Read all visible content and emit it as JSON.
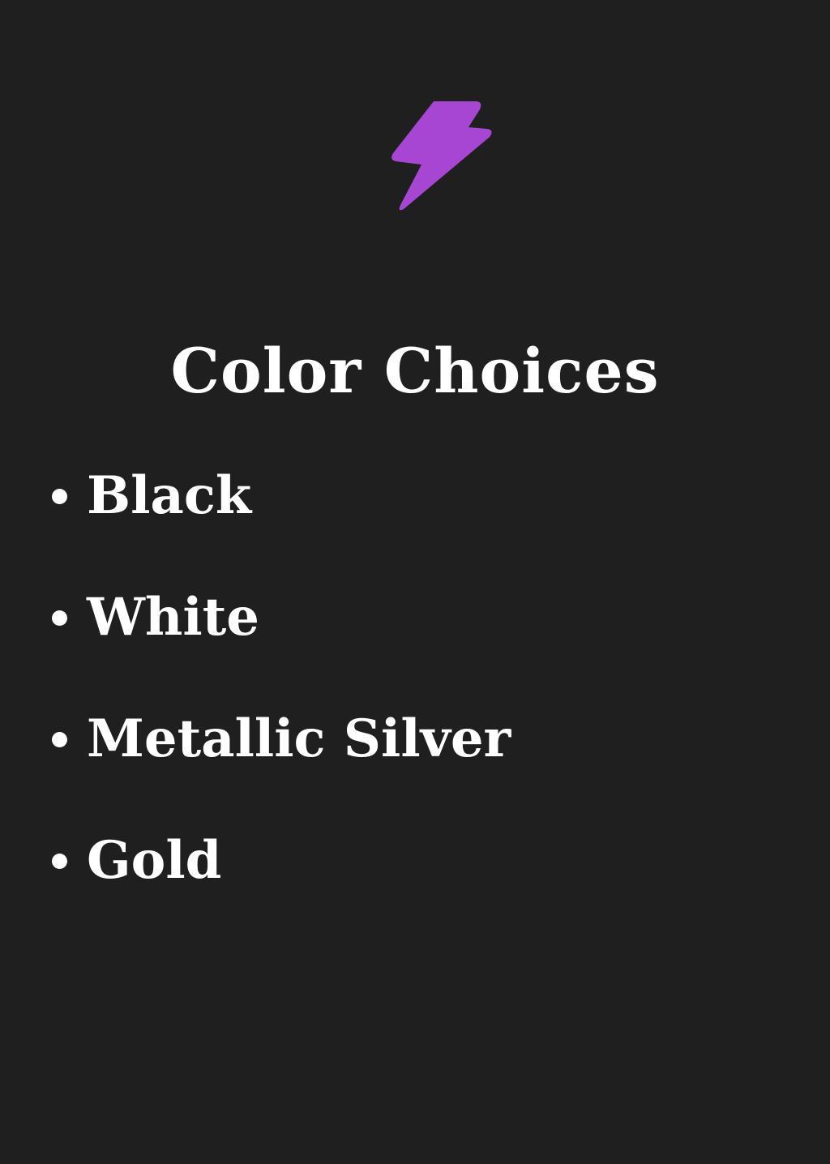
{
  "logo": {
    "icon": "lightning-bolt-icon",
    "color": "#a646d2"
  },
  "heading": "Color Choices",
  "colors": [
    {
      "label": "Black"
    },
    {
      "label": "White"
    },
    {
      "label": "Metallic Silver"
    },
    {
      "label": "Gold"
    }
  ],
  "theme": {
    "background": "#1f1f1f",
    "text": "#ffffff",
    "accent": "#a646d2"
  }
}
